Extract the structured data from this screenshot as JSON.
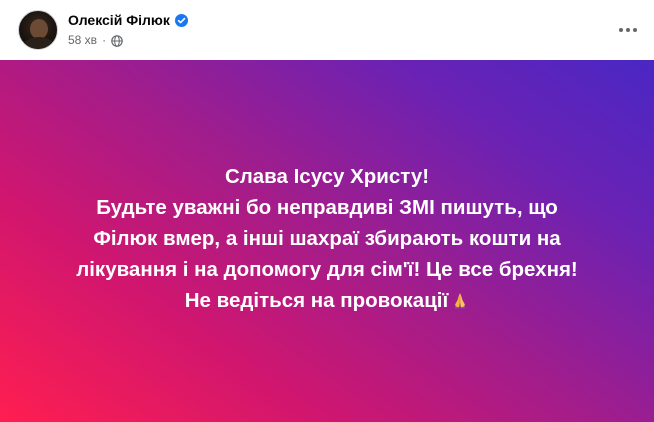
{
  "post": {
    "author_name": "Олексій Філюк",
    "verified_icon": "verified-badge-icon",
    "timestamp": "58 хв",
    "separator": "·",
    "audience_icon": "globe-icon",
    "more_icon": "more-options-icon",
    "banner": {
      "gradient_colors": [
        "#ff1e50",
        "#d0166f",
        "#a11d8c",
        "#6a22b4",
        "#4a27c4"
      ],
      "text_color": "#ffffff",
      "lines": [
        "Слава Ісусу Христу!",
        "Будьте уважні бо неправдиві ЗМІ пишуть, що",
        "Філюк вмер, а інші шахраї збирають кошти на",
        "лікування і на допомогу для сім'ї! Це все брехня!",
        "Не ведіться на провокації"
      ],
      "emoji": "folded-hands-icon"
    }
  },
  "colors": {
    "author": "#050505",
    "secondary_text": "#65676b",
    "verified": "#1877f2"
  }
}
